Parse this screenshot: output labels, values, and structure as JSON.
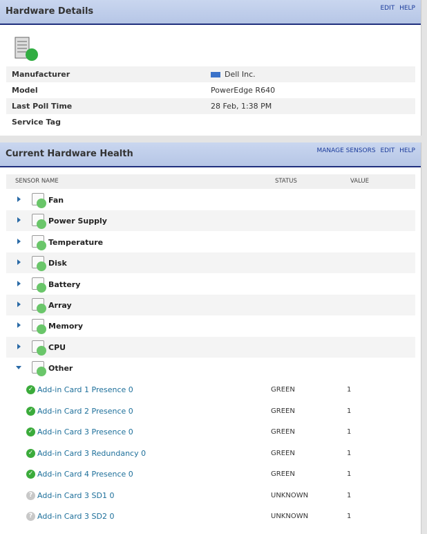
{
  "hardware_details": {
    "title": "Hardware Details",
    "links": [
      "EDIT",
      "HELP"
    ],
    "rows": [
      {
        "label": "Manufacturer",
        "value": "Dell Inc."
      },
      {
        "label": "Model",
        "value": "PowerEdge R640"
      },
      {
        "label": "Last Poll Time",
        "value": "28 Feb, 1:38 PM"
      },
      {
        "label": "Service Tag",
        "value": ""
      }
    ]
  },
  "hardware_health": {
    "title": "Current Hardware Health",
    "links": [
      "MANAGE SENSORS",
      "EDIT",
      "HELP"
    ],
    "columns": {
      "name": "SENSOR NAME",
      "status": "STATUS",
      "value": "VALUE"
    },
    "categories": [
      {
        "label": "Fan",
        "icon": "fan-icon",
        "expanded": false
      },
      {
        "label": "Power Supply",
        "icon": "power-plug-icon",
        "expanded": false
      },
      {
        "label": "Temperature",
        "icon": "thermometer-icon",
        "expanded": false
      },
      {
        "label": "Disk",
        "icon": "disk-icon",
        "expanded": false
      },
      {
        "label": "Battery",
        "icon": "battery-icon",
        "expanded": false
      },
      {
        "label": "Array",
        "icon": "array-icon",
        "expanded": false
      },
      {
        "label": "Memory",
        "icon": "memory-icon",
        "expanded": false
      },
      {
        "label": "CPU",
        "icon": "cpu-icon",
        "expanded": false
      },
      {
        "label": "Other",
        "icon": "other-icon",
        "expanded": true
      }
    ],
    "sensors": [
      {
        "name": "Add-in Card 1 Presence 0",
        "status": "GREEN",
        "value": "1",
        "state": "ok"
      },
      {
        "name": "Add-in Card 2 Presence 0",
        "status": "GREEN",
        "value": "1",
        "state": "ok"
      },
      {
        "name": "Add-in Card 3 Presence 0",
        "status": "GREEN",
        "value": "1",
        "state": "ok"
      },
      {
        "name": "Add-in Card 3 Redundancy 0",
        "status": "GREEN",
        "value": "1",
        "state": "ok"
      },
      {
        "name": "Add-in Card 4 Presence 0",
        "status": "GREEN",
        "value": "1",
        "state": "ok"
      },
      {
        "name": "Add-in Card 3 SD1 0",
        "status": "UNKNOWN",
        "value": "1",
        "state": "unknown"
      },
      {
        "name": "Add-in Card 3 SD2 0",
        "status": "UNKNOWN",
        "value": "1",
        "state": "unknown"
      }
    ]
  },
  "colors": {
    "header_bg": "#c9d6ef",
    "header_border": "#1f2f7d",
    "link": "#1a3a9a",
    "sensor_link": "#1d6f9a",
    "ok_green": "#3bab3b",
    "status_dot": "#6ac66a"
  }
}
